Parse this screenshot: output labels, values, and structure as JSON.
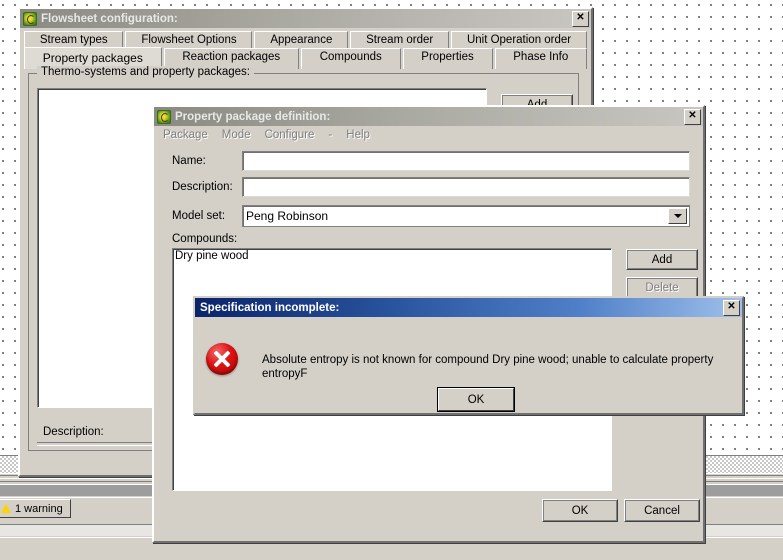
{
  "desktop": {
    "status_warning": "1 warning",
    "warning_icon": "warning-triangle-icon"
  },
  "flowsheet_window": {
    "title": "Flowsheet configuration:",
    "icon": "app-icon",
    "close_label": "✕",
    "tabs_row1": [
      {
        "label": "Stream types",
        "selected": false
      },
      {
        "label": "Flowsheet Options",
        "selected": false
      },
      {
        "label": "Appearance",
        "selected": false
      },
      {
        "label": "Stream order",
        "selected": false
      },
      {
        "label": "Unit Operation order",
        "selected": false
      }
    ],
    "tabs_row2": [
      {
        "label": "Property packages",
        "selected": true
      },
      {
        "label": "Reaction packages",
        "selected": false
      },
      {
        "label": "Compounds",
        "selected": false
      },
      {
        "label": "Properties",
        "selected": false
      },
      {
        "label": "Phase Info",
        "selected": false
      }
    ],
    "groupbox_label": "Thermo-systems and property packages:",
    "list_items": [],
    "add_button": "Add",
    "description_label": "Description:"
  },
  "property_package_window": {
    "title": "Property package definition:",
    "icon": "app-icon",
    "close_label": "✕",
    "menu": [
      {
        "label": "Package"
      },
      {
        "label": "Mode"
      },
      {
        "label": "Configure"
      },
      {
        "label": "-"
      },
      {
        "label": "Help"
      }
    ],
    "name_label": "Name:",
    "name_value": "",
    "description_label": "Description:",
    "description_value": "",
    "model_set_label": "Model set:",
    "model_set_value": "Peng Robinson",
    "compounds_label": "Compounds:",
    "compounds": [
      "Dry pine wood"
    ],
    "add_button": "Add",
    "delete_button": "Delete",
    "delete_disabled": true,
    "ok_button": "OK",
    "cancel_button": "Cancel"
  },
  "error_dialog": {
    "title": "Specification incomplete:",
    "close_label": "✕",
    "icon": "error-circle-x-icon",
    "message": "Absolute entropy is not known for compound Dry pine wood; unable to calculate property entropyF",
    "ok_button": "OK"
  },
  "colors": {
    "face": "#d4d0c8",
    "active_title_start": "#0a246a",
    "active_title_end": "#9fc0ea",
    "inactive_title_start": "#8a8a82",
    "inactive_title_end": "#c8c6c0",
    "error_red": "#e01414",
    "warning_yellow": "#ffd400"
  }
}
